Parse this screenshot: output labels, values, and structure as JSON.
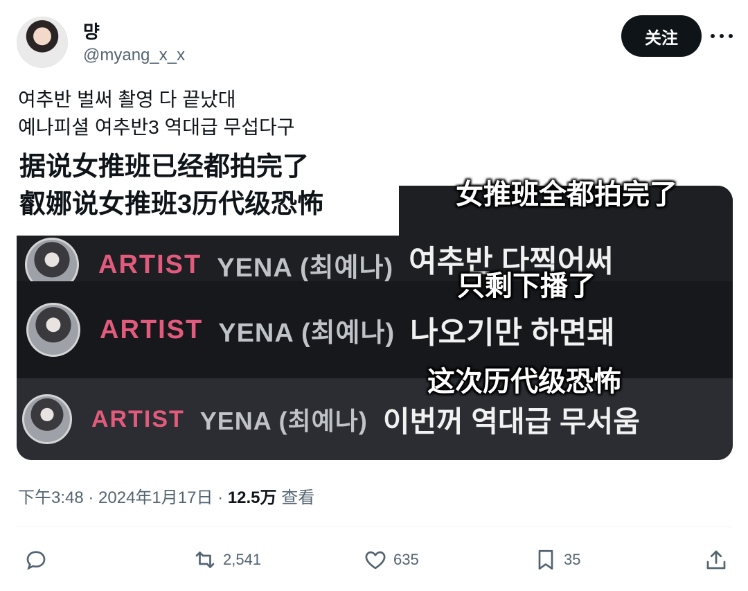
{
  "user": {
    "display_name": "먕",
    "handle": "@myang_x_x",
    "follow_label": "关注"
  },
  "tweet": {
    "lines": [
      "여추반 벌써 촬영 다 끝났대",
      "예나피셜 여추반3 역대급 무섭다구"
    ]
  },
  "media": {
    "caption_lines": [
      "据说女推班已经都拍完了",
      "叡娜说女推班3历代级恐怖"
    ],
    "rows": [
      {
        "artist": "ARTIST",
        "name": "YENA (최예나)",
        "message": "여추반 다찍어써"
      },
      {
        "artist": "ARTIST",
        "name": "YENA (최예나)",
        "message": "나오기만 하면돼"
      },
      {
        "artist": "ARTIST",
        "name": "YENA (최예나)",
        "message": "이번꺼 역대급 무서움"
      }
    ],
    "overlays": [
      "女推班全都拍完了",
      "只剩下播了",
      "这次历代级恐怖"
    ]
  },
  "meta": {
    "time": "下午3:48",
    "sep": " · ",
    "date": "2024年1月17日",
    "views_count": "12.5万",
    "views_label": "查看"
  },
  "actions": {
    "reply_icon": "reply-icon",
    "retweet_count": "2,541",
    "like_count": "635",
    "bookmark_count": "35",
    "share_icon": "share-icon"
  }
}
